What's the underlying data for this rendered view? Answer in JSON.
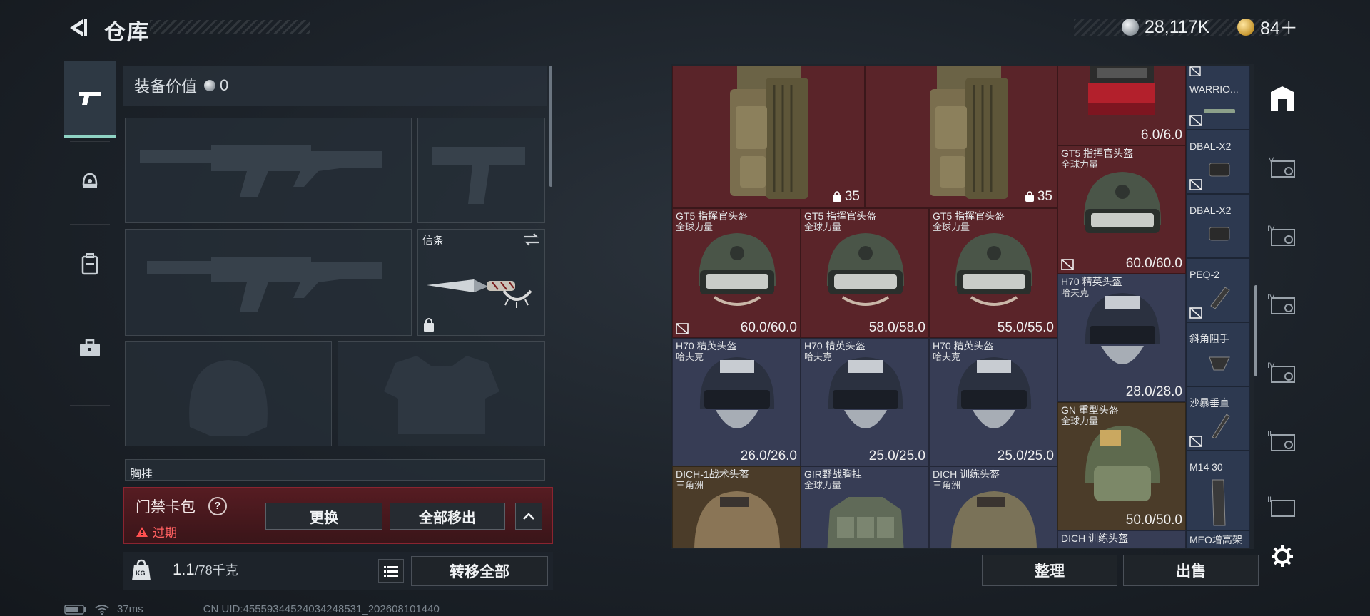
{
  "header": {
    "title": "仓库",
    "currency_silver": "28,117K",
    "currency_gold": "84＋"
  },
  "equipment": {
    "value_label": "装备价值",
    "value_amount": "0",
    "melee_label": "信条",
    "chest_label": "胸挂"
  },
  "keybag": {
    "title": "门禁卡包",
    "help": "?",
    "status": "过期",
    "replace_label": "更换",
    "remove_all_label": "全部移出"
  },
  "capacity": {
    "current": "1.1",
    "max": "/78千克",
    "badge": "KG",
    "transfer_all_label": "转移全部"
  },
  "status_bar": {
    "ping": "37ms",
    "uid": "CN UID:45559344524034248531_202608101440"
  },
  "stash": {
    "large_items": [
      {
        "qty": "35"
      },
      {
        "qty": "35"
      }
    ],
    "top_item_durability": "6.0/6.0",
    "rows": [
      [
        {
          "name": "GT5 指挥官头盔",
          "sub": "全球力量",
          "durability": "60.0/60.0",
          "nomark": true
        },
        {
          "name": "GT5 指挥官头盔",
          "sub": "全球力量",
          "durability": "58.0/58.0",
          "nomark": false
        },
        {
          "name": "GT5 指挥官头盔",
          "sub": "全球力量",
          "durability": "55.0/55.0",
          "nomark": false
        }
      ],
      [
        {
          "name": "H70 精英头盔",
          "sub": "哈夫克",
          "durability": "26.0/26.0"
        },
        {
          "name": "H70 精英头盔",
          "sub": "哈夫克",
          "durability": "25.0/25.0"
        },
        {
          "name": "H70 精英头盔",
          "sub": "哈夫克",
          "durability": "25.0/25.0"
        }
      ],
      [
        {
          "name": "DICH-1战术头盔",
          "sub": "三角洲"
        },
        {
          "name": "GIR野战胸挂",
          "sub": "全球力量"
        },
        {
          "name": "DICH 训练头盔",
          "sub": "三角洲"
        }
      ]
    ],
    "right_col": [
      {
        "name": "GT5 指挥官头盔",
        "sub": "全球力量",
        "durability": "60.0/60.0"
      },
      {
        "name": "H70 精英头盔",
        "sub": "哈夫克",
        "durability": "28.0/28.0"
      },
      {
        "name": "GN 重型头盔",
        "sub": "全球力量",
        "durability": "50.0/50.0"
      },
      {
        "name": "DICH 训练头盔",
        "sub": ""
      }
    ],
    "attachments": [
      "WARRIO...",
      "DBAL-X2",
      "DBAL-X2",
      "PEQ-2",
      "斜角阻手",
      "沙暴垂直",
      "M14 30",
      "MEO增高架"
    ],
    "sort_label": "整理",
    "sell_label": "出售"
  },
  "colors": {
    "rarity_red": "#5a2429",
    "rarity_brown": "#4b3c29",
    "rarity_purple": "#373d55",
    "accent_teal": "#8fd3c4",
    "warning_red": "#ff6060"
  },
  "icons": [
    "back-arrow-icon",
    "pistol-icon",
    "helmet-icon",
    "backpack-icon",
    "briefcase-icon",
    "lock-icon",
    "swap-icon",
    "weight-icon",
    "list-icon",
    "warehouse-icon",
    "settings-icon"
  ]
}
